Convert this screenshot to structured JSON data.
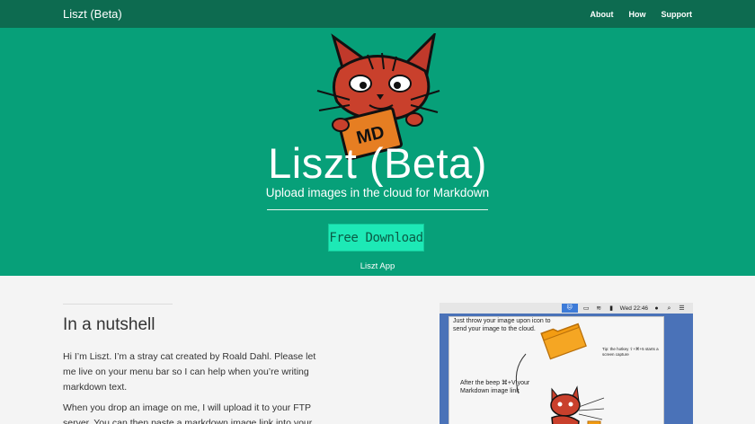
{
  "nav": {
    "brand": "Liszt (Beta)",
    "links": [
      "About",
      "How",
      "Support"
    ]
  },
  "hero": {
    "logo_text": "MD",
    "title": "Liszt (Beta)",
    "subtitle": "Upload images in the cloud for Markdown",
    "download_label": "Free Download",
    "app_label": "Liszt App"
  },
  "section": {
    "title": "In a nutshell",
    "para1": "Hi I’m Liszt. I’m a stray cat created by Roald Dahl. Please let me live on your menu bar so I can help when you’re writing markdown text.",
    "para2": "When you drop an image on me, I will upload it to your FTP server. You can then paste a markdown image link into your"
  },
  "screenshot": {
    "menubar_time": "Wed 22:46",
    "note1": "Just throw your image upon icon to send your image to the cloud.",
    "note2": "Tip: the hotkey ⇧+⌘+5 starts a screen capture",
    "note3": "After the beep ⌘+V your Markdown image link"
  },
  "colors": {
    "navbar": "#0d6b50",
    "hero": "#07a079",
    "button": "#1de9b6"
  }
}
